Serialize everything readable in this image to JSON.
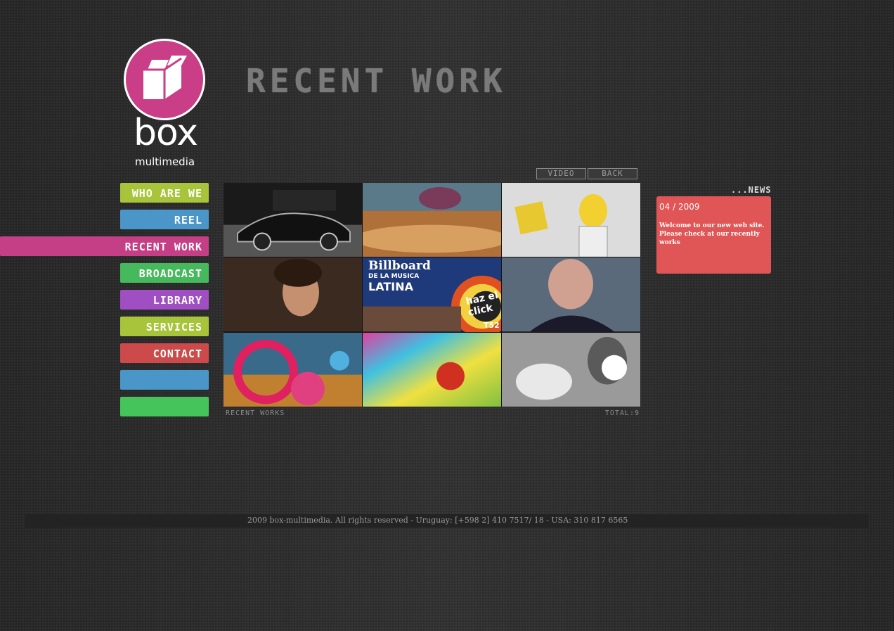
{
  "logo": {
    "word": "box",
    "sub": "multimedia"
  },
  "heading": "RECENT WORK",
  "nav": {
    "who": "WHO ARE WE",
    "reel": "REEL",
    "recent": "RECENT WORK",
    "broadcast": "BROADCAST",
    "library": "LIBRARY",
    "services": "SERVICES",
    "contact": "CONTACT"
  },
  "buttons": {
    "video": "VIDEO",
    "back": "BACK"
  },
  "grid": {
    "billboard_line1": "Billboard",
    "billboard_line2": "DE LA MUSICA",
    "billboard_line3": "LATINA",
    "haz_click": "haz el click",
    "badge": "T52"
  },
  "grid_footer": {
    "left": "RECENT WORKS",
    "right": "TOTAL:9"
  },
  "news": {
    "title": "...NEWS",
    "date": "04 / 2009",
    "text": "Welcome to our new web site. Please check at our recently works"
  },
  "footer": "2009 box-multimedia. All rights reserved - Uruguay: [+598 2] 410 7517/ 18  -  USA: 310 817 6565",
  "colors": {
    "accent_pink": "#c53f86",
    "lime": "#a8c43a",
    "blue": "#4a96c8",
    "green": "#45b95b",
    "purple": "#a04fc2",
    "red": "#cc4a4a",
    "news_red": "#e05555"
  }
}
